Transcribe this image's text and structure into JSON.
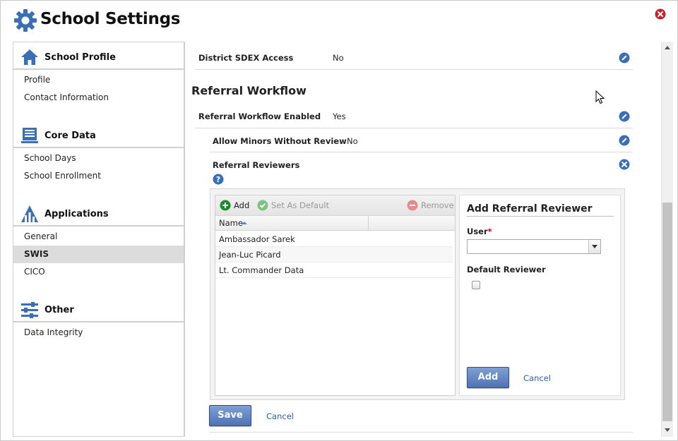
{
  "app": {
    "title": "School Settings"
  },
  "sidebar": {
    "sections": [
      {
        "label": "School Profile",
        "icon": "house-icon",
        "items": [
          "Profile",
          "Contact Information"
        ]
      },
      {
        "label": "Core Data",
        "icon": "document-stack-icon",
        "items": [
          "School Days",
          "School Enrollment"
        ]
      },
      {
        "label": "Applications",
        "icon": "pyramid-chart-icon",
        "items": [
          "General",
          "SWIS",
          "CICO"
        ],
        "active": "SWIS"
      },
      {
        "label": "Other",
        "icon": "sliders-icon",
        "items": [
          "Data Integrity"
        ]
      }
    ]
  },
  "main": {
    "district_sdex": {
      "label": "District SDEX Access",
      "value": "No"
    },
    "section_title": "Referral Workflow",
    "workflow_enabled": {
      "label": "Referral Workflow Enabled",
      "value": "Yes"
    },
    "allow_minors": {
      "label": "Allow Minors Without Review",
      "value": "No"
    },
    "reviewers_label": "Referral Reviewers",
    "toolbar": {
      "add": "Add",
      "set_default": "Set As Default",
      "remove": "Remove"
    },
    "grid": {
      "columns": [
        "Name",
        ""
      ],
      "rows": [
        "Ambassador Sarek",
        "Jean-Luc Picard",
        "Lt. Commander Data"
      ]
    },
    "form": {
      "title": "Add Referral Reviewer",
      "user_label": "User",
      "required_mark": "*",
      "user_value": "",
      "default_label": "Default Reviewer",
      "default_checked": false,
      "add_button": "Add",
      "cancel": "Cancel"
    },
    "save_button": "Save",
    "cancel": "Cancel"
  },
  "colors": {
    "accent": "#3a6fb6",
    "close": "#c8202c",
    "primary_button": "#5a7cbf",
    "link": "#2d5fa8"
  }
}
